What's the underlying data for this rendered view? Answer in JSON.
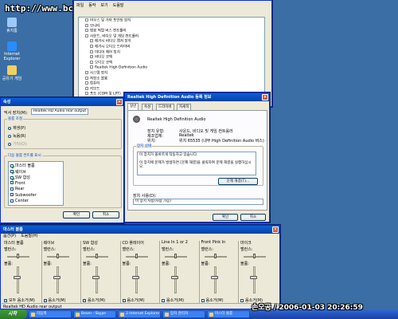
{
  "watermark_url": "http://www.bcpark.net",
  "watermark_stamp": "손오공 / 2006-01-03 20:26:59",
  "desktop_icons": [
    {
      "label": "휴지통",
      "icon": "recycle-bin-icon",
      "color": "#9fc7ff"
    },
    {
      "label": "Internet Explorer",
      "icon": "ie-icon",
      "color": "#2b8cff"
    },
    {
      "label": "공유기 게임",
      "icon": "folder-icon",
      "color": "#f2d060"
    }
  ],
  "device_manager": {
    "menu": [
      "파일",
      "동작",
      "보기",
      "도움말"
    ],
    "tree": [
      {
        "label": "마우스 및 기타 포인팅 장치",
        "indent": 1
      },
      {
        "label": "모니터",
        "indent": 1
      },
      {
        "label": "범용 직렬 버스 컨트롤러",
        "indent": 1
      },
      {
        "label": "사운드, 비디오 및 게임 컨트롤러",
        "indent": 1
      },
      {
        "label": "레거시 비디오 캡처 장치",
        "indent": 2
      },
      {
        "label": "레거시 오디오 드라이버",
        "indent": 2
      },
      {
        "label": "미디어 제어 장치",
        "indent": 2
      },
      {
        "label": "비디오 코덱",
        "indent": 2
      },
      {
        "label": "오디오 코덱",
        "indent": 2
      },
      {
        "label": "Realtek High Definition Audio",
        "indent": 2
      },
      {
        "label": "시스템 장치",
        "indent": 1
      },
      {
        "label": "저장소 볼륨",
        "indent": 1
      },
      {
        "label": "컴퓨터",
        "indent": 1
      },
      {
        "label": "키보드",
        "indent": 1
      },
      {
        "label": "포트 (COM 및 LPT)",
        "indent": 1
      }
    ]
  },
  "properties_dialog": {
    "title": "속성",
    "mixer_device_label": "믹서 장치(M):",
    "mixer_device_value": "Realtek HD Audio rear output",
    "adjust_group": "볼륨 조절",
    "radio_playback": "재생(P)",
    "radio_record": "녹음(R)",
    "radio_other": "기타(O):",
    "show_group": "다음 볼륨 컨트롤 표시:",
    "controls": [
      {
        "label": "마스터 볼륨",
        "checked": true
      },
      {
        "label": "웨이브",
        "checked": true
      },
      {
        "label": "SW 합성",
        "checked": true
      },
      {
        "label": "Front",
        "checked": false
      },
      {
        "label": "Rear",
        "checked": false
      },
      {
        "label": "Subwoofer",
        "checked": false
      },
      {
        "label": "Center",
        "checked": false
      }
    ],
    "ok": "확인",
    "cancel": "취소"
  },
  "audio_props": {
    "title": "Realtek High Definition Audio 등록 정보",
    "tabs": [
      "일반",
      "속성",
      "드라이버",
      "자세히"
    ],
    "device_name": "Realtek High Definition Audio",
    "rows": [
      {
        "k": "장치 유형:",
        "v": "사운드, 비디오 및 게임 컨트롤러"
      },
      {
        "k": "제조업체:",
        "v": "Realtek"
      },
      {
        "k": "위치:",
        "v": "위치 65535 (내부 High Definition Audio 버스)"
      }
    ],
    "status_group": "장치 상태",
    "status_text": "이 장치가 올바르게 작동하고 있습니다.\n\n이 장치에 문제가 발생하면 [문제 해결]을 클릭하여 문제 해결을 실행하십시오.",
    "troubleshoot": "문제 해결(T)...",
    "usage_label": "장치 사용(D):",
    "usage_value": "이 장치 사용(사용 가능)",
    "ok": "확인",
    "cancel": "취소"
  },
  "mixer": {
    "title": "마스터 볼륨",
    "menu": [
      "옵션(P)",
      "도움말(H)"
    ],
    "balance_label": "밸런스:",
    "volume_label": "볼륨:",
    "master_mute_label": "모두 음소거(M)",
    "mute_label": "음소거(M)",
    "columns": [
      {
        "name": "마스터 볼륨",
        "balance": 0.5,
        "volume": 0.6
      },
      {
        "name": "웨이브",
        "balance": 0.5,
        "volume": 0.6
      },
      {
        "name": "SW 합성",
        "balance": 0.5,
        "volume": 0.6
      },
      {
        "name": "CD 플레이어",
        "balance": 0.5,
        "volume": 0.6
      },
      {
        "name": "Line In 1 or 2",
        "balance": 0.5,
        "volume": 0.6
      },
      {
        "name": "Front Pink In",
        "balance": 0.5,
        "volume": 0.6
      },
      {
        "name": "마이크",
        "balance": 0.5,
        "volume": 0.6
      }
    ],
    "status": "Realtek HD Audio rear output"
  },
  "taskbar": {
    "start": "시작",
    "items": [
      "리듬액",
      "Beam - Skype",
      "2 Internet Explorer",
      "장치 관리자",
      "마스터 볼륨"
    ]
  },
  "colors": {
    "titlebar": "#0a5fd8",
    "desktop": "#3a6ea5",
    "taskbar": "#245edb"
  }
}
